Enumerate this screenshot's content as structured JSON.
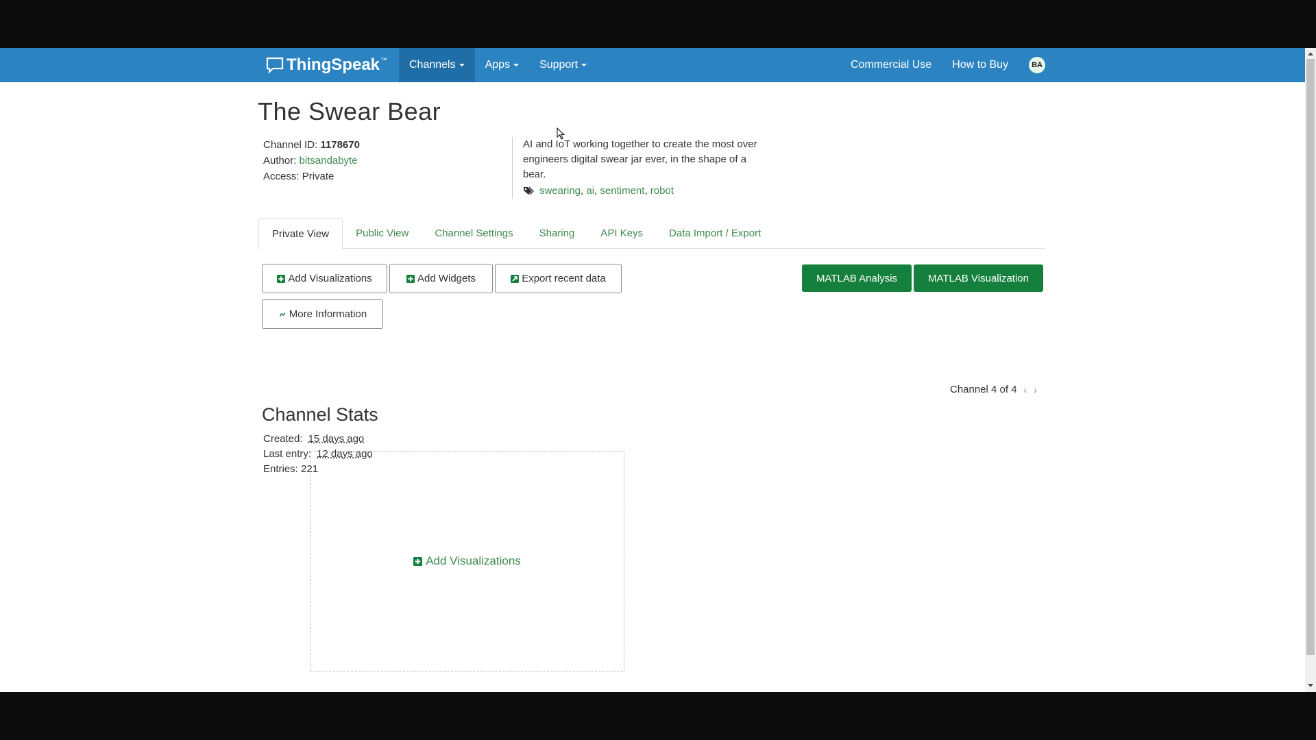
{
  "brand": {
    "name": "ThingSpeak",
    "tm": "™"
  },
  "nav": {
    "items": [
      {
        "label": "Channels",
        "active": true
      },
      {
        "label": "Apps"
      },
      {
        "label": "Support"
      }
    ],
    "right": [
      {
        "label": "Commercial Use"
      },
      {
        "label": "How to Buy"
      }
    ],
    "avatar_initials": "BA"
  },
  "channel": {
    "title": "The Swear Bear",
    "id_label": "Channel ID:",
    "id_value": "1178670",
    "author_label": "Author:",
    "author_value": "bitsandabyte",
    "access_label": "Access:",
    "access_value": "Private",
    "description": "AI and IoT working together to create the most over engineers digital swear jar ever, in the shape of a bear.",
    "tags": [
      "swearing",
      "ai",
      "sentiment",
      "robot"
    ]
  },
  "tabs": [
    "Private View",
    "Public View",
    "Channel Settings",
    "Sharing",
    "API Keys",
    "Data Import / Export"
  ],
  "buttons": {
    "add_visualizations": "Add Visualizations",
    "add_widgets": "Add Widgets",
    "export_recent": "Export recent data",
    "more_info": "More Information",
    "matlab_analysis": "MATLAB Analysis",
    "matlab_visualization": "MATLAB Visualization"
  },
  "pager": {
    "label": "Channel 4 of 4"
  },
  "stats": {
    "title": "Channel Stats",
    "created_label": "Created:",
    "created_value": "15 days ago",
    "last_entry_label": "Last entry:",
    "last_entry_value": "12 days ago",
    "entries_label": "Entries:",
    "entries_value": "221"
  },
  "viz_box": {
    "link": "Add Visualizations"
  },
  "colors": {
    "topbar": "#2c83c1",
    "active_nav": "#1f6ea8",
    "link_green": "#3d8a4c",
    "button_green": "#15803d"
  }
}
